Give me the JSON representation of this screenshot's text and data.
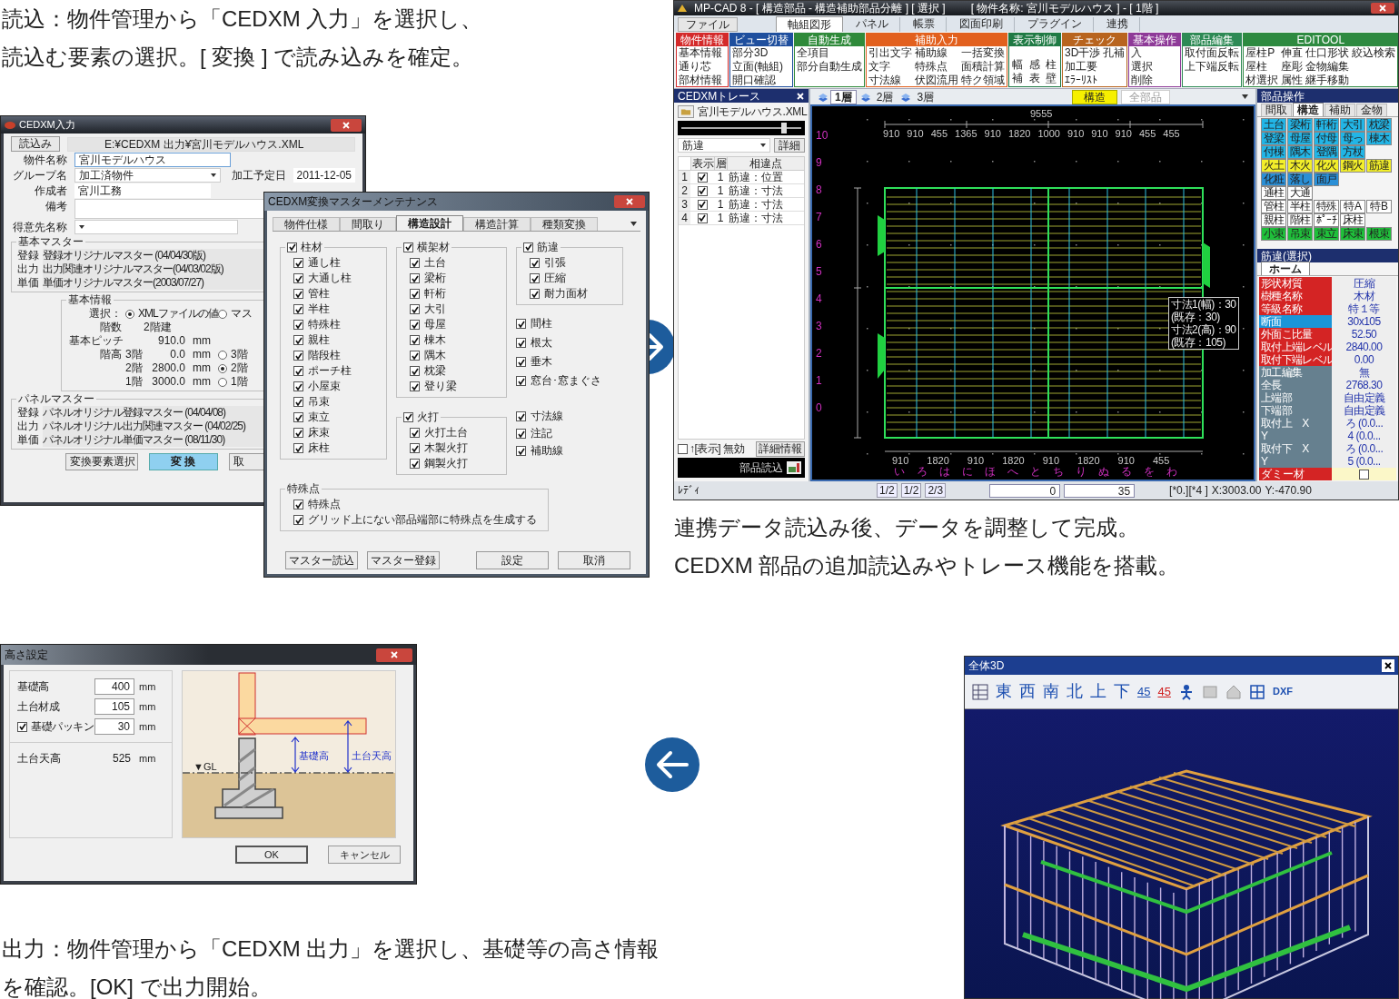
{
  "captions": {
    "top_left": [
      "読込：物件管理から「CEDXM 入力」を選択し、",
      "読込む要素の選択。[ 変換 ] で読み込みを確定。"
    ],
    "top_right": [
      "連携データ読込み後、データを調整して完成。",
      "CEDXM 部品の追加読込みやトレース機能を搭載。"
    ],
    "bottom_left": [
      "出力：物件管理から「CEDXM 出力」を選択し、基礎等の高さ情報",
      "を確認。[OK] で出力開始。"
    ]
  },
  "input_dialog": {
    "title": "CEDXM入力",
    "load_button": "読込み",
    "file_path": "E:¥CEDXM 出力¥宮川モデルハウス.XML",
    "fields": [
      {
        "label": "物件名称",
        "value": "宮川モデルハウス",
        "kind": "text"
      },
      {
        "label": "グループ名",
        "value": "加工済物件",
        "kind": "dropdown"
      },
      {
        "label": "作成者",
        "value": "宮川工務",
        "kind": "text"
      },
      {
        "label": "備考",
        "kind": "textarea"
      },
      {
        "label": "得意先名称",
        "kind": "dropdown"
      }
    ],
    "date": {
      "label": "加工予定日",
      "value": "2011-12-05"
    },
    "basic_master": {
      "title": "基本マスター",
      "rows": [
        {
          "label": "登録",
          "value": "登録オリジナルマスター (04/04/30版)"
        },
        {
          "label": "出力",
          "value": "出力関連オリジナルマスター(04/03/02版)"
        },
        {
          "label": "単価",
          "value": "単価オリジナルマスター(2003/07/27)"
        }
      ]
    },
    "basic_info": {
      "title": "基本情報",
      "select_label": "選択：",
      "options": [
        {
          "label": "XMLファイルの値",
          "selected": true
        },
        {
          "label": "マス",
          "selected": false
        }
      ],
      "floors_label": "階数",
      "floors_value": "2階建",
      "pitch_label": "基本ピッチ",
      "pitch_value": "910.0",
      "pitch_unit": "mm",
      "height_label": "階高",
      "heights": [
        {
          "floor": "3階",
          "value": "0.0",
          "unit": "mm",
          "option": "3階",
          "selected": false
        },
        {
          "floor": "2階",
          "value": "2800.0",
          "unit": "mm",
          "option": "2階",
          "selected": true
        },
        {
          "floor": "1階",
          "value": "3000.0",
          "unit": "mm",
          "option": "1階",
          "selected": false
        }
      ]
    },
    "panel_master": {
      "title": "パネルマスター",
      "rows": [
        {
          "label": "登録",
          "value": "パネルオリジナル登録マスター (04/04/08)"
        },
        {
          "label": "出力",
          "value": "パネルオリジナル出力関連マスター (04/02/25)"
        },
        {
          "label": "単価",
          "value": "パネルオリジナル単価マスター (08/11/30)"
        }
      ]
    },
    "buttons": [
      {
        "label": "変換要素選択",
        "selected": false
      },
      {
        "label": "変 換",
        "selected": true
      },
      {
        "label": "取",
        "selected": false
      }
    ]
  },
  "master_dialog": {
    "title": "CEDXM変換マスターメンテナンス",
    "tabs": [
      {
        "label": "物件仕様",
        "selected": false
      },
      {
        "label": "間取り",
        "selected": false
      },
      {
        "label": "構造設計",
        "selected": true
      },
      {
        "label": "構造計算",
        "selected": false
      },
      {
        "label": "種類変換",
        "selected": false
      }
    ],
    "column_1": [
      {
        "label": "柱材",
        "checked": true,
        "items": [
          {
            "label": "通し柱",
            "checked": true
          },
          {
            "label": "大通し柱",
            "checked": true
          },
          {
            "label": "管柱",
            "checked": true
          },
          {
            "label": "半柱",
            "checked": true
          },
          {
            "label": "特殊柱",
            "checked": true
          },
          {
            "label": "親柱",
            "checked": true
          },
          {
            "label": "階段柱",
            "checked": true
          },
          {
            "label": "ポーチ柱",
            "checked": true
          },
          {
            "label": "小屋束",
            "checked": true
          },
          {
            "label": "吊束",
            "checked": true
          },
          {
            "label": "束立",
            "checked": true
          },
          {
            "label": "床束",
            "checked": true
          },
          {
            "label": "床柱",
            "checked": true
          }
        ]
      }
    ],
    "column_2": [
      {
        "label": "横架材",
        "checked": true,
        "items": [
          {
            "label": "土台",
            "checked": true
          },
          {
            "label": "梁桁",
            "checked": true
          },
          {
            "label": "軒桁",
            "checked": true
          },
          {
            "label": "大引",
            "checked": true
          },
          {
            "label": "母屋",
            "checked": true
          },
          {
            "label": "棟木",
            "checked": true
          },
          {
            "label": "隅木",
            "checked": true
          },
          {
            "label": "枕梁",
            "checked": true
          },
          {
            "label": "登り梁",
            "checked": true
          }
        ]
      },
      {
        "label": "火打",
        "checked": true,
        "items": [
          {
            "label": "火打土台",
            "checked": true
          },
          {
            "label": "木製火打",
            "checked": true
          },
          {
            "label": "鋼製火打",
            "checked": true
          }
        ]
      }
    ],
    "column_3": {
      "group": {
        "label": "筋違",
        "checked": true,
        "items": [
          {
            "label": "引張",
            "checked": true
          },
          {
            "label": "圧縮",
            "checked": true
          },
          {
            "label": "耐力面材",
            "checked": true
          }
        ]
      },
      "options_a": [
        {
          "label": "間柱",
          "checked": true
        },
        {
          "label": "根太",
          "checked": true
        },
        {
          "label": "垂木",
          "checked": true
        },
        {
          "label": "窓台･窓まぐさ",
          "checked": true
        }
      ],
      "options_b": [
        {
          "label": "寸法線",
          "checked": true
        },
        {
          "label": "注記",
          "checked": true
        },
        {
          "label": "補助線",
          "checked": true
        }
      ]
    },
    "special": {
      "title": "特殊点",
      "items": [
        {
          "label": "特殊点",
          "checked": true
        },
        {
          "label": "グリッド上にない部品端部に特殊点を生成する",
          "checked": true
        }
      ]
    },
    "buttons": [
      "マスター読込",
      "マスター登録",
      "設定",
      "取消"
    ]
  },
  "cad_window": {
    "title": "MP-CAD 8 - [ 構造部品 - 構造補助部品分離 ] [ 選択 ]",
    "subtitle": "[ 物件名称: 宮川モデルハウス ] - [ 1階 ]",
    "menu_tabs": [
      {
        "label": "ファイル",
        "selected": false
      },
      {
        "label": "軸組図形",
        "selected": true
      },
      {
        "label": "パネル",
        "selected": false
      },
      {
        "label": "帳票",
        "selected": false
      },
      {
        "label": "図面印刷",
        "selected": false
      },
      {
        "label": "プラグイン",
        "selected": false
      },
      {
        "label": "連携",
        "selected": false
      }
    ],
    "ribbon": [
      {
        "title": "物件情報",
        "color": "#d42a2a",
        "kind": "columns",
        "items": [
          "基本情報",
          "通り芯",
          "部材情報"
        ]
      },
      {
        "title": "ビュー切替",
        "color": "#1f4f9e",
        "kind": "columns",
        "items": [
          "部分3D",
          "立面(軸組)",
          "開口確認"
        ]
      },
      {
        "title": "自動生成",
        "color": "#2f8a3a",
        "kind": "columns",
        "items": [
          "全項目",
          "部分自動生成"
        ]
      },
      {
        "title": "補助入力",
        "color": "#e2601e",
        "kind": "columns",
        "items": [
          "引出文字",
          "文字",
          "寸法線",
          "補助線",
          "特殊点",
          "伏図流用",
          "一括変換",
          "面積計算",
          "特ク領域"
        ]
      },
      {
        "title": "表示制御",
        "color": "#1f7a44",
        "kind": "rows",
        "items": [
          "幅",
          "感",
          "柱",
          "補",
          "表",
          "壁"
        ]
      },
      {
        "title": "チェック",
        "color": "#b8641e",
        "kind": "columns",
        "items": [
          "3D干渉",
          "加工要",
          "ｴﾗｰﾘｽﾄ",
          "孔補"
        ]
      },
      {
        "title": "基本操作",
        "color": "#8e3a98",
        "kind": "columns",
        "items": [
          "入",
          "選択",
          "削除"
        ]
      },
      {
        "title": "部品編集",
        "color": "#2e8a55",
        "kind": "columns",
        "items": [
          "取付面反転",
          "上下端反転"
        ]
      },
      {
        "title": "EDITOOL",
        "color": "#2e8a40",
        "kind": "columns",
        "items": [
          "屋柱P",
          "屋柱",
          "材選択",
          "伸直",
          "座彫",
          "属性",
          "仕口形状",
          "金物編集",
          "継手移動",
          "絞込検索"
        ]
      }
    ],
    "trace_panel": {
      "title": "CEDXMトレース",
      "file": "宮川モデルハウス.XML",
      "slider": {
        "level": 0.85
      },
      "filter": "筋違",
      "detail_button": "詳細",
      "columns": [
        "表示",
        "層",
        "相違点"
      ],
      "rows": [
        {
          "index": "1",
          "shown": true,
          "layer": "1",
          "difference": "筋違：位置"
        },
        {
          "index": "2",
          "shown": true,
          "layer": "1",
          "difference": "筋違：寸法"
        },
        {
          "index": "3",
          "shown": true,
          "layer": "1",
          "difference": "筋違：寸法"
        },
        {
          "index": "4",
          "shown": true,
          "layer": "1",
          "difference": "筋違：寸法"
        }
      ],
      "disable_option": {
        "label": "↑[表示] 無効",
        "checked": false
      },
      "info_button": "詳細情報",
      "load_button": "部品読込"
    },
    "floor_tabs": [
      {
        "label": "1層",
        "selected": true
      },
      {
        "label": "2層",
        "selected": false
      },
      {
        "label": "3層",
        "selected": false
      }
    ],
    "view_tabs": [
      {
        "label": "構造",
        "selected": true
      },
      {
        "label": "全部品",
        "selected": false
      }
    ],
    "canvas": {
      "y_labels": [
        "10",
        "9",
        "8",
        "7",
        "6",
        "5",
        "4",
        "3",
        "2",
        "1",
        "0"
      ],
      "x_labels": [
        "い",
        "ろ",
        "は",
        "に",
        "ほ",
        "へ",
        "と",
        "ち",
        "り",
        "ぬ",
        "る",
        "を",
        "わ"
      ],
      "overall_dim": "9555",
      "top_dims": [
        "910",
        "910",
        "455",
        "1365",
        "910",
        "1820",
        "1000",
        "910",
        "910",
        "910",
        "455",
        "455"
      ],
      "bottom_dims": [
        "910",
        "1820",
        "910",
        "1820",
        "910",
        "1820",
        "910",
        "455"
      ],
      "info": [
        "寸法1(幅)：30",
        "(既存：30)",
        "寸法2(高)：90",
        "(既存：105)"
      ]
    },
    "parts_panel": {
      "title": "部品操作",
      "tabs": [
        {
          "label": "間取",
          "selected": false
        },
        {
          "label": "構造",
          "selected": true
        },
        {
          "label": "補助",
          "selected": false
        },
        {
          "label": "金物",
          "selected": false
        }
      ],
      "buttons": [
        [
          {
            "label": "土台",
            "color": "#22b5e6"
          },
          {
            "label": "梁桁",
            "color": "#22b5e6"
          },
          {
            "label": "軒桁",
            "color": "#22b5e6"
          },
          {
            "label": "大引",
            "color": "#22b5e6"
          },
          {
            "label": "枕梁",
            "color": "#22b5e6"
          }
        ],
        [
          {
            "label": "登梁",
            "color": "#22b5e6"
          },
          {
            "label": "母屋",
            "color": "#22b5e6"
          },
          {
            "label": "付母",
            "color": "#22b5e6"
          },
          {
            "label": "母っ",
            "color": "#22b5e6"
          },
          {
            "label": "棟木",
            "color": "#22b5e6"
          }
        ],
        [
          {
            "label": "付棟",
            "color": "#22b5e6"
          },
          {
            "label": "隅木",
            "color": "#22b5e6"
          },
          {
            "label": "登隅",
            "color": "#22b5e6"
          },
          {
            "label": "方杖",
            "color": "#22b5e6"
          }
        ],
        [
          {
            "label": "火土",
            "color": "#f2ee2a"
          },
          {
            "label": "木火",
            "color": "#f2ee2a"
          },
          {
            "label": "化火",
            "color": "#f2ee2a"
          },
          {
            "label": "鋼火",
            "color": "#f2ee2a"
          },
          {
            "label": "筋違",
            "color": "#f2ee2a"
          }
        ],
        [
          {
            "label": "化粧",
            "color": "#2a8fd6"
          },
          {
            "label": "落し",
            "color": "#2a8fd6"
          },
          {
            "label": "面戸",
            "color": "#2a8fd6"
          }
        ],
        [
          {
            "label": "通柱",
            "color": "#ffffff"
          },
          {
            "label": "大通",
            "color": "#ffffff"
          }
        ],
        [
          {
            "label": "管柱",
            "color": "#ffffff"
          },
          {
            "label": "半柱",
            "color": "#ffffff"
          },
          {
            "label": "特殊",
            "color": "#ffffff"
          },
          {
            "label": "特A",
            "color": "#ffffff"
          },
          {
            "label": "特B",
            "color": "#ffffff"
          }
        ],
        [
          {
            "label": "親柱",
            "color": "#ffffff"
          },
          {
            "label": "階柱",
            "color": "#ffffff"
          },
          {
            "label": "ﾎﾟｰﾁ",
            "color": "#ffffff"
          },
          {
            "label": "床柱",
            "color": "#ffffff"
          }
        ],
        [
          {
            "label": "小束",
            "color": "#1fbf3a"
          },
          {
            "label": "吊束",
            "color": "#1fbf3a"
          },
          {
            "label": "束立",
            "color": "#1fbf3a"
          },
          {
            "label": "床束",
            "color": "#1fbf3a"
          },
          {
            "label": "根束",
            "color": "#1fbf3a"
          }
        ]
      ]
    },
    "property_panel": {
      "title": "筋違(選択)",
      "tab": "ホーム",
      "rows": [
        {
          "label": "形状材質",
          "value": "圧縮",
          "color": "#d42424"
        },
        {
          "label": "樹種名称",
          "value": "木材",
          "color": "#d42424"
        },
        {
          "label": "等級名称",
          "value": "特１等",
          "color": "#d42424"
        },
        {
          "label": "断面",
          "value": "30x105",
          "color": "#1a95d8"
        },
        {
          "label": "外面こ比量",
          "value": "52.50",
          "color": "#d42424"
        },
        {
          "label": "取付上端レベル",
          "value": "2840.00",
          "color": "#d42424"
        },
        {
          "label": "取付下端レベル",
          "value": "0.00",
          "color": "#d42424"
        },
        {
          "label": "加工編集",
          "value": "無",
          "color": "#66808f"
        },
        {
          "label": "全長",
          "value": "2768.30",
          "color": "#66808f"
        },
        {
          "label": "上端部",
          "value": "自由定義",
          "color": "#66808f"
        },
        {
          "label": "下端部",
          "value": "自由定義",
          "color": "#66808f"
        },
        {
          "label": "取付上　X",
          "value": "ろ (0.0...",
          "color": "#66808f"
        },
        {
          "label": "Y",
          "value": "4 (0.0...",
          "color": "#66808f"
        },
        {
          "label": "取付下　X",
          "value": "ろ (0.0...",
          "color": "#66808f"
        },
        {
          "label": "Y",
          "value": "5 (0.0...",
          "color": "#66808f"
        }
      ],
      "dummy": {
        "label": "ダミー材",
        "checked": false
      }
    },
    "status": {
      "ready": "ﾚﾃﾞｨ",
      "pages": [
        "1/2",
        "1/2",
        "2/3"
      ],
      "field_1": "0",
      "field_2": "35",
      "cell": "[*0.][*4 ]",
      "x": "X:3003.00",
      "y": "Y:-470.90"
    }
  },
  "height_dialog": {
    "title": "高さ設定",
    "fields": [
      {
        "label": "基礎高",
        "value": "400",
        "unit": "mm",
        "kind": "plain"
      },
      {
        "label": "土台材成",
        "value": "105",
        "unit": "mm",
        "kind": "plain"
      },
      {
        "label": "基礎パッキン",
        "value": "30",
        "unit": "mm",
        "kind": "checkbox",
        "checked": true
      }
    ],
    "result": {
      "label": "土台天高",
      "value": "525",
      "unit": "mm"
    },
    "diagram": {
      "gl": "▼GL",
      "foundation": "基礎高",
      "sill_top": "土台天高"
    },
    "buttons": [
      "OK",
      "キャンセル"
    ]
  },
  "view3d_window": {
    "title": "全体3D",
    "directions": [
      "東",
      "西",
      "南",
      "北",
      "上",
      "下"
    ],
    "angles": [
      "45",
      "45"
    ],
    "export": "DXF"
  }
}
